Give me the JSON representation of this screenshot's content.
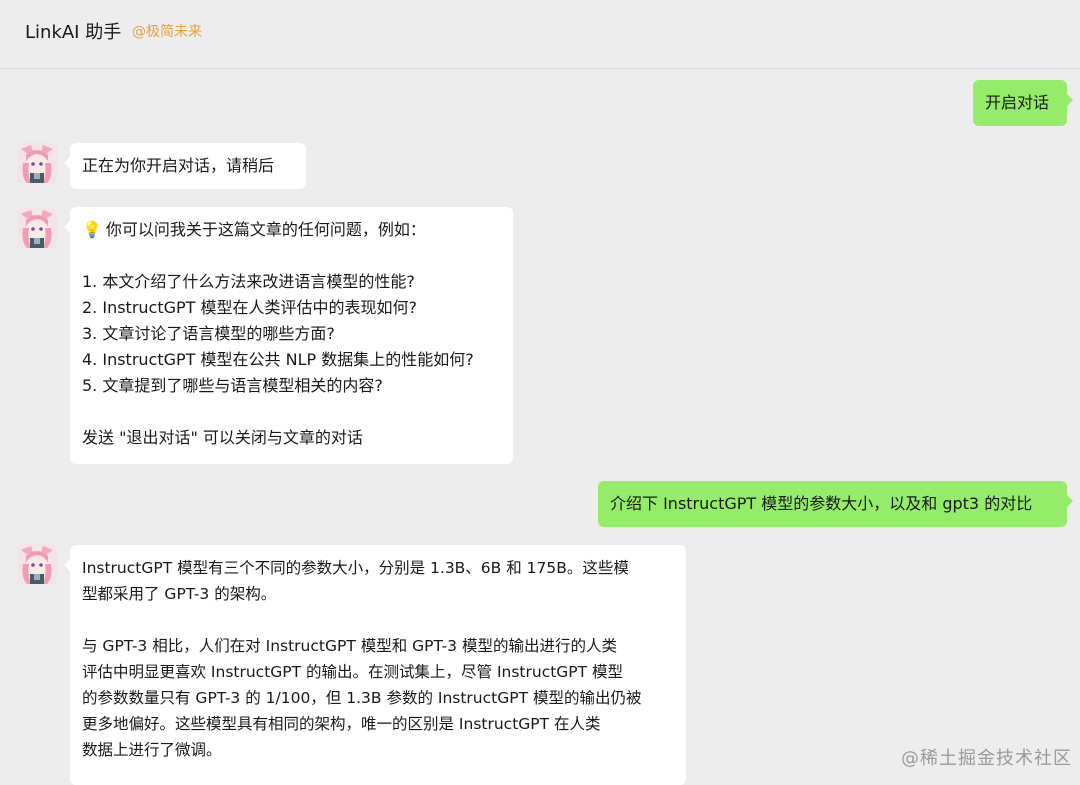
{
  "header": {
    "title": "LinkAI 助手",
    "tag": "@极简未来"
  },
  "messages": [
    {
      "from": "me",
      "text": "开启对话"
    },
    {
      "from": "bot",
      "text": "正在为你开启对话，请稍后"
    },
    {
      "from": "bot",
      "lines": [
        "你可以问我关于这篇文章的任何问题，例如：",
        "",
        "1. 本文介绍了什么方法来改进语言模型的性能?",
        "2. InstructGPT 模型在人类评估中的表现如何?",
        "3. 文章讨论了语言模型的哪些方面?",
        "4. InstructGPT 模型在公共 NLP 数据集上的性能如何?",
        "5. 文章提到了哪些与语言模型相关的内容?",
        "",
        "发送 \"退出对话\" 可以关闭与文章的对话"
      ]
    },
    {
      "from": "me",
      "text": "介绍下 InstructGPT 模型的参数大小，以及和 gpt3 的对比"
    },
    {
      "from": "bot",
      "lines": [
        "InstructGPT 模型有三个不同的参数大小，分别是 1.3B、6B 和 175B。这些模",
        "型都采用了 GPT-3 的架构。",
        "",
        "与 GPT-3 相比，人们在对 InstructGPT 模型和 GPT-3 模型的输出进行的人类",
        "评估中明显更喜欢 InstructGPT 的输出。在测试集上，尽管 InstructGPT 模型",
        "的参数数量只有 GPT-3 的 1/100，但 1.3B 参数的 InstructGPT 模型的输出仍被",
        "更多地偏好。这些模型具有相同的架构，唯一的区别是 InstructGPT 在人类",
        "数据上进行了微调。"
      ]
    }
  ],
  "icons": {
    "bulb": "💡"
  },
  "watermark": "@稀土掘金技术社区"
}
